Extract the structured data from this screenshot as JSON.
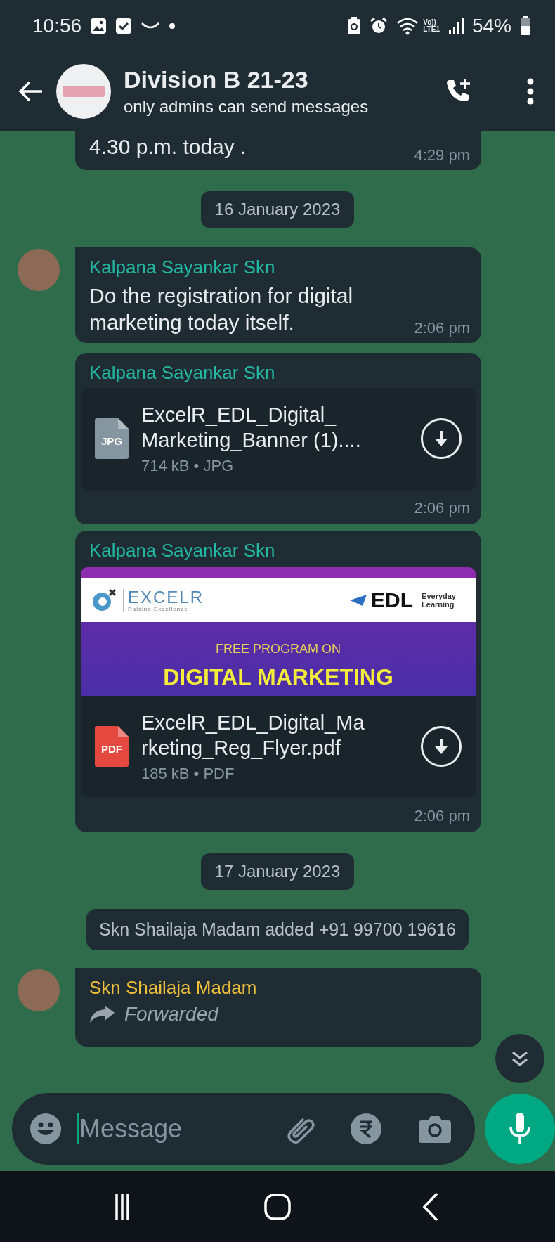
{
  "status_bar": {
    "time": "10:56",
    "network_type": [
      "Vo))",
      "LTE1"
    ],
    "battery": "54%"
  },
  "header": {
    "title": "Division B 21-23",
    "subtitle": "only admins can send messages"
  },
  "messages": [
    {
      "kind": "continuation",
      "text": "4.30 p.m. today .",
      "time": "4:29 pm"
    },
    {
      "kind": "date",
      "text": "16 January 2023"
    },
    {
      "kind": "text",
      "sender": "Kalpana Sayankar Skn",
      "color": "#23b8a2",
      "avatar": true,
      "text": "Do the registration for digital marketing today itself.",
      "time": "2:06 pm"
    },
    {
      "kind": "document",
      "sender": "Kalpana Sayankar Skn",
      "color": "#23b8a2",
      "avatar": false,
      "file_type": "JPG",
      "file_name_lines": [
        "ExcelR_EDL_Digital_",
        "Marketing_Banner (1)...."
      ],
      "file_info": "714 kB • JPG",
      "time": "2:06 pm"
    },
    {
      "kind": "image_document",
      "sender": "Kalpana Sayankar Skn",
      "color": "#23b8a2",
      "avatar": false,
      "banner": {
        "brand_left": "EXCELR",
        "tagline": "Raising Excellence",
        "brand_right": "EDL",
        "brand_right_sub": [
          "Everyday",
          "Learning"
        ],
        "subheading": "FREE PROGRAM ON",
        "heading": "DIGITAL MARKETING"
      },
      "file_type": "PDF",
      "file_name_lines": [
        "ExcelR_EDL_Digital_Ma",
        "rketing_Reg_Flyer.pdf"
      ],
      "file_info": "185 kB • PDF",
      "time": "2:06 pm"
    },
    {
      "kind": "date",
      "text": "17 January 2023"
    },
    {
      "kind": "system",
      "text": "Skn Shailaja Madam added +91 99700 19616"
    },
    {
      "kind": "forwarded",
      "sender": "Skn Shailaja Madam",
      "color": "#efbf3c",
      "avatar": true,
      "label": "Forwarded"
    }
  ],
  "composer": {
    "placeholder": "Message"
  }
}
